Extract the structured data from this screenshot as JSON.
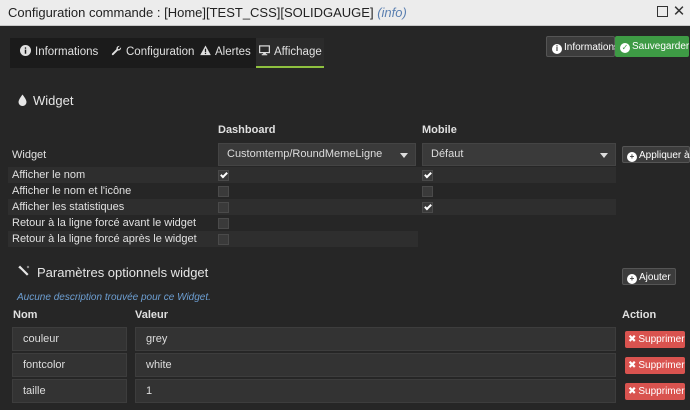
{
  "window": {
    "title": "Configuration commande : [Home][TEST_CSS][SOLIDGAUGE]",
    "title_info": "(info)",
    "maximize_icon": "maximize-icon",
    "close_icon": "close-icon"
  },
  "tabs": [
    {
      "label": "Informations",
      "icon": "info-circle-icon"
    },
    {
      "label": "Configuration",
      "icon": "wrench-icon"
    },
    {
      "label": "Alertes",
      "icon": "warning-triangle-icon"
    },
    {
      "label": "Affichage",
      "icon": "desktop-icon",
      "active": true
    }
  ],
  "actions": {
    "informations_label": "Informations",
    "save_label": "Sauvegarder"
  },
  "widget_section": {
    "title": "Widget",
    "icon": "droplet-icon",
    "col_dashboard": "Dashboard",
    "col_mobile": "Mobile",
    "widget_label": "Widget",
    "dashboard_value": "Customtemp/RoundMemeLigne",
    "mobile_value": "Défaut",
    "apply_label": "Appliquer à",
    "options": [
      {
        "label": "Afficher le nom",
        "dashboard": true,
        "mobile": true
      },
      {
        "label": "Afficher le nom et l'icône",
        "dashboard": false,
        "mobile": false
      },
      {
        "label": "Afficher les statistiques",
        "dashboard": false,
        "mobile": true
      },
      {
        "label": "Retour à la ligne forcé avant le widget",
        "dashboard": false,
        "mobile": null
      },
      {
        "label": "Retour à la ligne forcé après le widget",
        "dashboard": false,
        "mobile": null
      }
    ]
  },
  "params_section": {
    "title": "Paramètres optionnels widget",
    "icon": "magic-wand-icon",
    "add_label": "Ajouter",
    "description": "Aucune description trouvée pour ce Widget.",
    "col_name": "Nom",
    "col_value": "Valeur",
    "col_action": "Action",
    "delete_label": "Supprimer",
    "rows": [
      {
        "name": "couleur",
        "value": "grey"
      },
      {
        "name": "fontcolor",
        "value": "white"
      },
      {
        "name": "taille",
        "value": "1"
      }
    ]
  },
  "colors": {
    "accent_green": "#3e9b45",
    "tab_underline": "#8fc13f",
    "danger_red": "#d9534f",
    "link_blue": "#6d9fd3"
  }
}
